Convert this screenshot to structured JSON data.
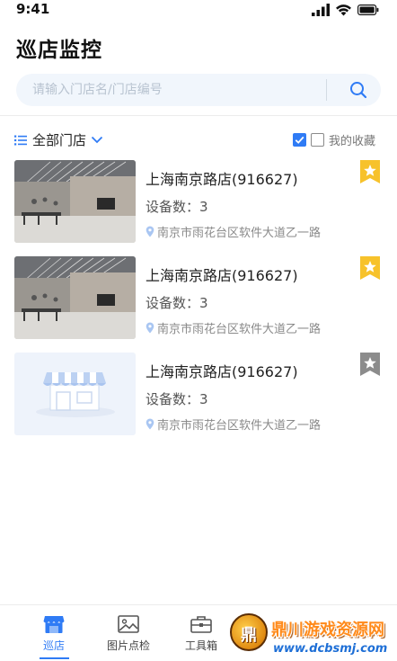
{
  "status": {
    "time": "9:41"
  },
  "header": {
    "title": "巡店监控"
  },
  "search": {
    "placeholder": "请输入门店名/门店编号"
  },
  "filter": {
    "scope_label": "全部门店",
    "favorites_label": "我的收藏",
    "favorites_checked": false,
    "all_checked": true
  },
  "stores": [
    {
      "name": "上海南京路店(916627)",
      "devices": "设备数：3",
      "address": "南京市雨花台区软件大道乙一路",
      "favorited": true,
      "image": "store-photo"
    },
    {
      "name": "上海南京路店(916627)",
      "devices": "设备数：3",
      "address": "南京市雨花台区软件大道乙一路",
      "favorited": true,
      "image": "store-photo"
    },
    {
      "name": "上海南京路店(916627)",
      "devices": "设备数：3",
      "address": "南京市雨花台区软件大道乙一路",
      "favorited": false,
      "image": "store-placeholder"
    }
  ],
  "tabs": [
    {
      "label": "巡店",
      "icon": "store-icon",
      "active": true
    },
    {
      "label": "图片点检",
      "icon": "image-icon",
      "active": false
    },
    {
      "label": "工具箱",
      "icon": "toolbox-icon",
      "active": false
    }
  ],
  "watermark": {
    "logo_char": "鼎",
    "title": "鼎川游戏资源网",
    "url": "www.dcbsmj.com"
  },
  "colors": {
    "accent": "#2f7bf5",
    "star_active": "#f7c22b",
    "star_inactive": "#8c8c8c",
    "search_bg": "#f1f6fc"
  }
}
